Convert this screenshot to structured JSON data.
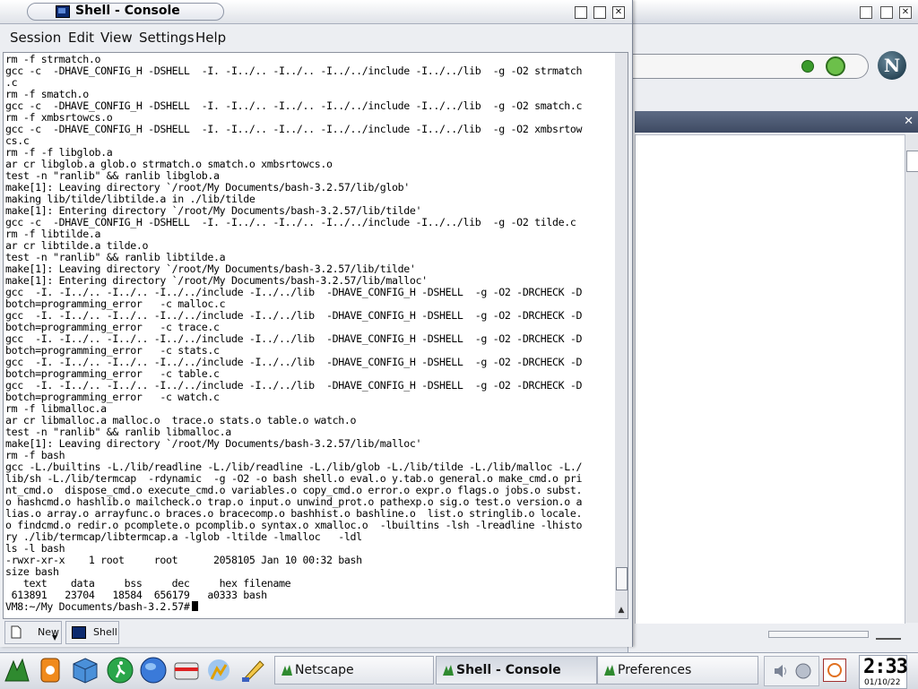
{
  "console": {
    "title": "Shell - Console",
    "controls": {
      "minimize": "▢",
      "maximize": "▢",
      "close": "✕"
    },
    "menu": [
      "Session",
      "Edit",
      "View",
      "Settings",
      "Help"
    ],
    "terminal_text": "rm -f strmatch.o\ngcc -c  -DHAVE_CONFIG_H -DSHELL  -I. -I../.. -I../.. -I../../include -I../../lib  -g -O2 strmatch\n.c\nrm -f smatch.o\ngcc -c  -DHAVE_CONFIG_H -DSHELL  -I. -I../.. -I../.. -I../../include -I../../lib  -g -O2 smatch.c\nrm -f xmbsrtowcs.o\ngcc -c  -DHAVE_CONFIG_H -DSHELL  -I. -I../.. -I../.. -I../../include -I../../lib  -g -O2 xmbsrtow\ncs.c\nrm -f -f libglob.a\nar cr libglob.a glob.o strmatch.o smatch.o xmbsrtowcs.o\ntest -n \"ranlib\" && ranlib libglob.a\nmake[1]: Leaving directory `/root/My Documents/bash-3.2.57/lib/glob'\nmaking lib/tilde/libtilde.a in ./lib/tilde\nmake[1]: Entering directory `/root/My Documents/bash-3.2.57/lib/tilde'\ngcc -c  -DHAVE_CONFIG_H -DSHELL  -I. -I../.. -I../.. -I../../include -I../../lib  -g -O2 tilde.c\nrm -f libtilde.a\nar cr libtilde.a tilde.o\ntest -n \"ranlib\" && ranlib libtilde.a\nmake[1]: Leaving directory `/root/My Documents/bash-3.2.57/lib/tilde'\nmake[1]: Entering directory `/root/My Documents/bash-3.2.57/lib/malloc'\ngcc  -I. -I../.. -I../.. -I../../include -I../../lib  -DHAVE_CONFIG_H -DSHELL  -g -O2 -DRCHECK -D\nbotch=programming_error   -c malloc.c\ngcc  -I. -I../.. -I../.. -I../../include -I../../lib  -DHAVE_CONFIG_H -DSHELL  -g -O2 -DRCHECK -D\nbotch=programming_error   -c trace.c\ngcc  -I. -I../.. -I../.. -I../../include -I../../lib  -DHAVE_CONFIG_H -DSHELL  -g -O2 -DRCHECK -D\nbotch=programming_error   -c stats.c\ngcc  -I. -I../.. -I../.. -I../../include -I../../lib  -DHAVE_CONFIG_H -DSHELL  -g -O2 -DRCHECK -D\nbotch=programming_error   -c table.c\ngcc  -I. -I../.. -I../.. -I../../include -I../../lib  -DHAVE_CONFIG_H -DSHELL  -g -O2 -DRCHECK -D\nbotch=programming_error   -c watch.c\nrm -f libmalloc.a\nar cr libmalloc.a malloc.o  trace.o stats.o table.o watch.o\ntest -n \"ranlib\" && ranlib libmalloc.a\nmake[1]: Leaving directory `/root/My Documents/bash-3.2.57/lib/malloc'\nrm -f bash\ngcc -L./builtins -L./lib/readline -L./lib/readline -L./lib/glob -L./lib/tilde -L./lib/malloc -L./\nlib/sh -L./lib/termcap  -rdynamic  -g -O2 -o bash shell.o eval.o y.tab.o general.o make_cmd.o pri\nnt_cmd.o  dispose_cmd.o execute_cmd.o variables.o copy_cmd.o error.o expr.o flags.o jobs.o subst.\no hashcmd.o hashlib.o mailcheck.o trap.o input.o unwind_prot.o pathexp.o sig.o test.o version.o a\nlias.o array.o arrayfunc.o braces.o bracecomp.o bashhist.o bashline.o  list.o stringlib.o locale.\no findcmd.o redir.o pcomplete.o pcomplib.o syntax.o xmalloc.o  -lbuiltins -lsh -lreadline -lhisto\nry ./lib/termcap/libtermcap.a -lglob -ltilde -lmalloc   -ldl\nls -l bash\n-rwxr-xr-x    1 root     root      2058105 Jan 10 00:32 bash\nsize bash\n   text    data     bss     dec     hex filename\n 613891   23704   18584  656179   a0333 bash",
    "prompt": "VM8:~/My Documents/bash-3.2.57#",
    "tabs": {
      "new_label": "New",
      "shell_label": "Shell"
    }
  },
  "background_window": {
    "logo_letter": "N",
    "controls": {
      "minimize": "▢",
      "maximize": "▢",
      "close": "✕"
    },
    "sidebar_close": "✕"
  },
  "taskbar": {
    "tasks": [
      {
        "label": "Netscape",
        "active": false
      },
      {
        "label": "Shell - Console",
        "active": true
      },
      {
        "label": "Preferences",
        "active": false
      }
    ],
    "clock": {
      "time": "2:33",
      "date": "01/10/22"
    }
  },
  "colors": {
    "terminal_bg": "#ffffff",
    "terminal_fg": "#000000",
    "title_active": "#000000"
  }
}
